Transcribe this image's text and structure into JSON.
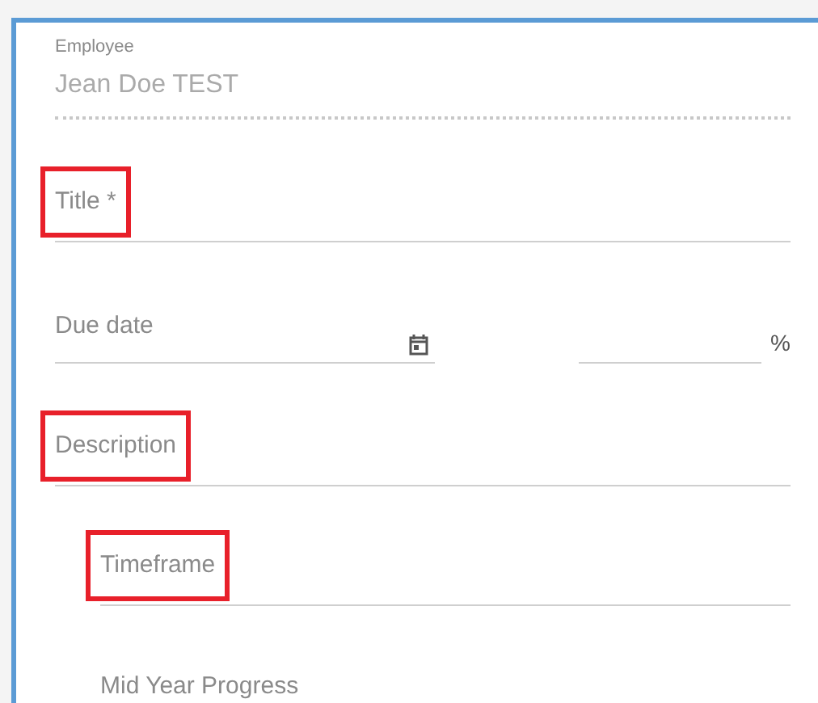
{
  "employee": {
    "label": "Employee",
    "value": "Jean Doe TEST"
  },
  "fields": [
    {
      "kind": "text",
      "placeholder": "Title *",
      "highlighted": true
    },
    {
      "kind": "date-percent",
      "placeholder": "Due date",
      "suffix": "%",
      "highlighted": false
    },
    {
      "kind": "text",
      "placeholder": "Description",
      "highlighted": true
    },
    {
      "kind": "subtext",
      "placeholder": "Timeframe",
      "highlighted": true
    },
    {
      "kind": "heading",
      "placeholder": "Mid Year Progress",
      "highlighted": false
    }
  ]
}
